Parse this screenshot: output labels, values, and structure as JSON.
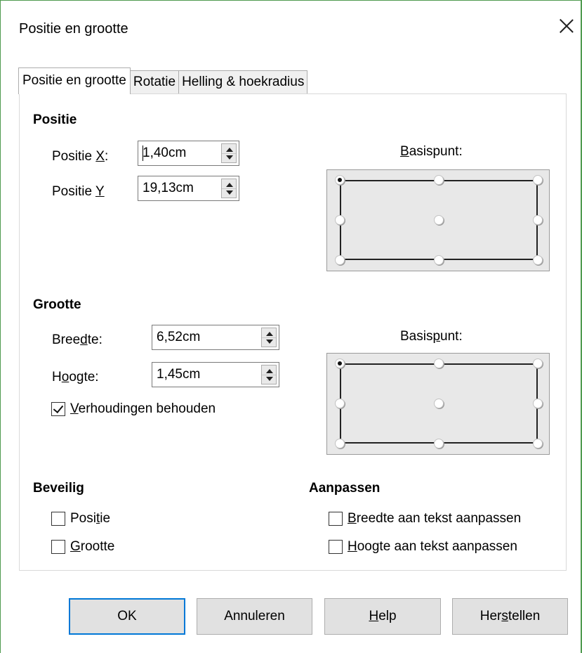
{
  "window": {
    "title": "Positie en grootte"
  },
  "tabs": [
    {
      "label": "Positie en grootte"
    },
    {
      "label": "Rotatie"
    },
    {
      "label": "Helling & hoekradius"
    }
  ],
  "position": {
    "heading": "Positie",
    "x_label_pre": "Positie ",
    "x_label_key": "X",
    "x_label_post": ":",
    "x_value": "1,40cm",
    "y_label_pre": "Positie ",
    "y_label_key": "Y",
    "y_label_post": "",
    "y_value": "19,13cm",
    "basepoint_pre": "",
    "basepoint_key": "B",
    "basepoint_post": "asispunt:"
  },
  "size": {
    "heading": "Grootte",
    "width_pre": "Bree",
    "width_key": "d",
    "width_post": "te:",
    "width_value": "6,52cm",
    "height_pre": "H",
    "height_key": "o",
    "height_post": "ogte:",
    "height_value": "1,45cm",
    "keep_ratio_key": "V",
    "keep_ratio_post": "erhoudingen behouden",
    "basepoint_pre": "Basis",
    "basepoint_key": "p",
    "basepoint_post": "unt:"
  },
  "protect": {
    "heading": "Beveilig",
    "pos_pre": "Posi",
    "pos_key": "t",
    "pos_post": "ie",
    "size_key": "G",
    "size_post": "rootte"
  },
  "fit": {
    "heading": "Aanpassen",
    "width_key": "B",
    "width_post": "reedte aan tekst aanpassen",
    "height_key": "H",
    "height_post": "oogte aan tekst aanpassen"
  },
  "buttons": {
    "ok": "OK",
    "cancel": "Annuleren",
    "help_key": "H",
    "help_post": "elp",
    "reset_pre": "Her",
    "reset_key": "s",
    "reset_post": "tellen"
  }
}
